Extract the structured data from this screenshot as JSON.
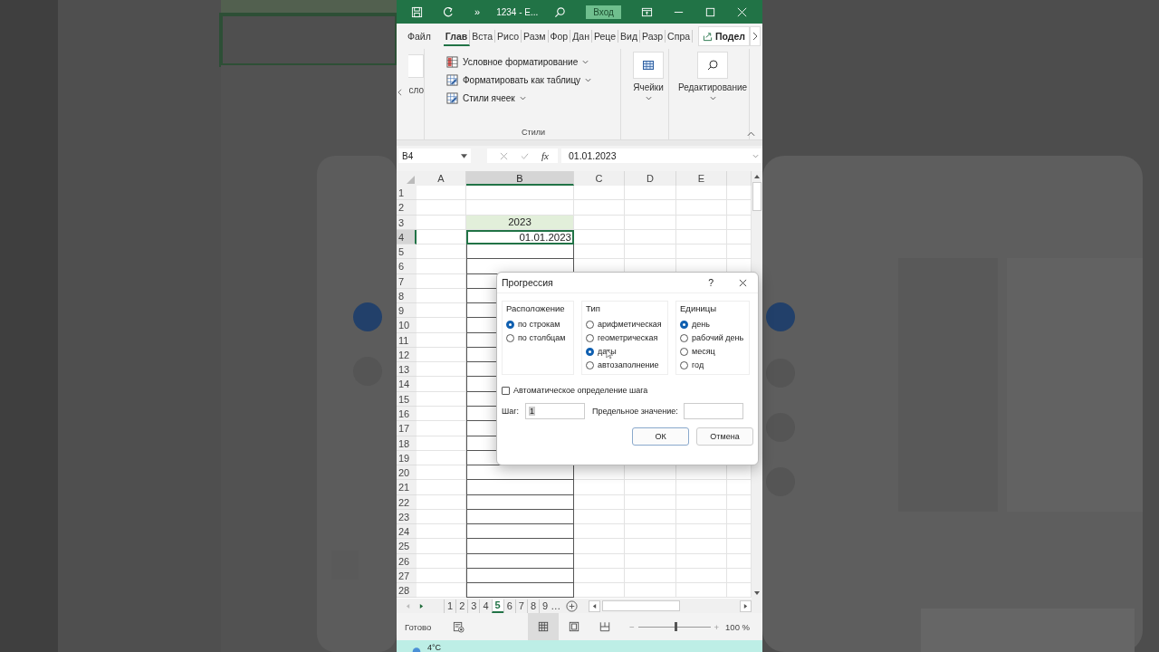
{
  "title_bar": {
    "more": "»",
    "document": "1234 - E...",
    "signin": "Вход"
  },
  "ribbon_tabs": [
    {
      "label": "Файл",
      "selected": false
    },
    {
      "label": "Глав",
      "selected": true
    },
    {
      "label": "Вста",
      "selected": false
    },
    {
      "label": "Рисо",
      "selected": false
    },
    {
      "label": "Разм",
      "selected": false
    },
    {
      "label": "Фор",
      "selected": false
    },
    {
      "label": "Дан",
      "selected": false
    },
    {
      "label": "Реце",
      "selected": false
    },
    {
      "label": "Вид",
      "selected": false
    },
    {
      "label": "Разр",
      "selected": false
    },
    {
      "label": "Спра",
      "selected": false
    }
  ],
  "share_button": "Подел",
  "ribbon": {
    "number_group_label": "сло",
    "styles": [
      "Условное форматирование",
      "Форматировать как таблицу",
      "Стили ячеек"
    ],
    "styles_group": "Стили",
    "cells": "Ячейки",
    "editing": "Редактирование"
  },
  "formula_bar": {
    "name_box": "B4",
    "fx": "fx",
    "formula": "01.01.2023"
  },
  "columns": [
    {
      "label": "A",
      "selected": false
    },
    {
      "label": "B",
      "selected": true
    },
    {
      "label": "C",
      "selected": false
    },
    {
      "label": "D",
      "selected": false
    },
    {
      "label": "E",
      "selected": false
    }
  ],
  "rows": [
    {
      "number": "1",
      "selected": false,
      "highlighted": false,
      "bordered": false
    },
    {
      "number": "2",
      "selected": false,
      "highlighted": false,
      "bordered": false
    },
    {
      "number": "3",
      "selected": false,
      "highlighted": true,
      "bordered": false,
      "cell_b": "2023",
      "kind": "label"
    },
    {
      "number": "4",
      "selected": true,
      "highlighted": false,
      "bordered": false,
      "cell_b": "01.01.2023",
      "kind": "value"
    },
    {
      "number": "5",
      "selected": false,
      "highlighted": false,
      "bordered": true
    },
    {
      "number": "6",
      "selected": false,
      "highlighted": false,
      "bordered": true
    },
    {
      "number": "7",
      "selected": false,
      "highlighted": false,
      "bordered": true
    },
    {
      "number": "8",
      "selected": false,
      "highlighted": false,
      "bordered": true
    },
    {
      "number": "9",
      "selected": false,
      "highlighted": false,
      "bordered": true
    },
    {
      "number": "10",
      "selected": false,
      "highlighted": false,
      "bordered": true
    },
    {
      "number": "11",
      "selected": false,
      "highlighted": false,
      "bordered": true
    },
    {
      "number": "12",
      "selected": false,
      "highlighted": false,
      "bordered": true
    },
    {
      "number": "13",
      "selected": false,
      "highlighted": false,
      "bordered": true
    },
    {
      "number": "14",
      "selected": false,
      "highlighted": false,
      "bordered": true
    },
    {
      "number": "15",
      "selected": false,
      "highlighted": false,
      "bordered": true
    },
    {
      "number": "16",
      "selected": false,
      "highlighted": false,
      "bordered": true
    },
    {
      "number": "17",
      "selected": false,
      "highlighted": false,
      "bordered": true
    },
    {
      "number": "18",
      "selected": false,
      "highlighted": false,
      "bordered": true
    },
    {
      "number": "19",
      "selected": false,
      "highlighted": false,
      "bordered": true
    },
    {
      "number": "20",
      "selected": false,
      "highlighted": false,
      "bordered": true
    },
    {
      "number": "21",
      "selected": false,
      "highlighted": false,
      "bordered": true
    },
    {
      "number": "22",
      "selected": false,
      "highlighted": false,
      "bordered": true
    },
    {
      "number": "23",
      "selected": false,
      "highlighted": false,
      "bordered": true
    },
    {
      "number": "24",
      "selected": false,
      "highlighted": false,
      "bordered": true
    },
    {
      "number": "25",
      "selected": false,
      "highlighted": false,
      "bordered": true
    },
    {
      "number": "26",
      "selected": false,
      "highlighted": false,
      "bordered": true
    },
    {
      "number": "27",
      "selected": false,
      "highlighted": false,
      "bordered": true
    },
    {
      "number": "28",
      "selected": false,
      "highlighted": false,
      "bordered": true
    }
  ],
  "sheet_tabs": [
    {
      "label": "1",
      "selected": false
    },
    {
      "label": "2",
      "selected": false
    },
    {
      "label": "3",
      "selected": false
    },
    {
      "label": "4",
      "selected": false
    },
    {
      "label": "5",
      "selected": true
    },
    {
      "label": "6",
      "selected": false
    },
    {
      "label": "7",
      "selected": false
    },
    {
      "label": "8",
      "selected": false
    },
    {
      "label": "9",
      "selected": false
    }
  ],
  "sheet_more": "…",
  "status_bar": {
    "status": "Готово",
    "views": [
      {
        "kind": "normal",
        "selected": true
      },
      {
        "kind": "page_layout",
        "selected": false
      },
      {
        "kind": "page_break",
        "selected": false
      }
    ],
    "zoom_out": "−",
    "zoom": {
      "level": 0.5
    },
    "zoom_in": "+",
    "zoom_text": "100 %"
  },
  "taskbar": {
    "temperature": "4°C"
  },
  "dialog": {
    "title": "Прогрессия",
    "help": "?",
    "groups": [
      {
        "title": "Расположение",
        "options": [
          {
            "label": "по строкам",
            "selected": true
          },
          {
            "label": "по столбцам",
            "selected": false
          }
        ]
      },
      {
        "title": "Тип",
        "options": [
          {
            "label": "арифметическая",
            "selected": false
          },
          {
            "label": "геометрическая",
            "selected": false
          },
          {
            "label": "даты",
            "selected": true
          },
          {
            "label": "автозаполнение",
            "selected": false
          }
        ]
      },
      {
        "title": "Единицы",
        "options": [
          {
            "label": "день",
            "selected": true
          },
          {
            "label": "рабочий день",
            "selected": false
          },
          {
            "label": "месяц",
            "selected": false
          },
          {
            "label": "год",
            "selected": false
          }
        ]
      }
    ],
    "checkbox": {
      "label": "Автоматическое определение шага",
      "checked": false
    },
    "step": {
      "label": "Шаг:",
      "value": "1"
    },
    "stop": {
      "label": "Предельное значение:"
    },
    "buttons": [
      {
        "label": "ОК",
        "default": true
      },
      {
        "label": "Отмена",
        "default": false
      }
    ]
  }
}
